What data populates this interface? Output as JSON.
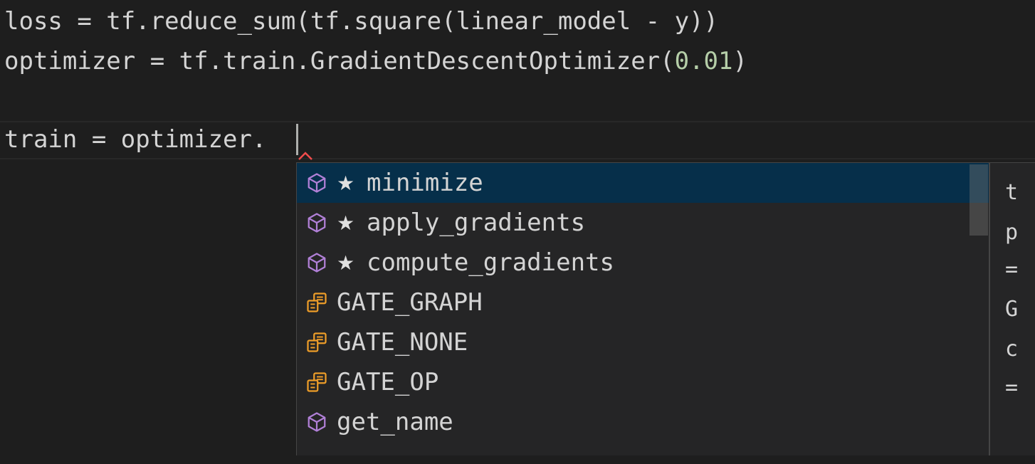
{
  "editor": {
    "lines": [
      {
        "text": "loss = tf.reduce_sum(tf.square(linear_model - y))"
      },
      {
        "prefix": "optimizer = tf.train.GradientDescentOptimizer(",
        "number": "0.01",
        "suffix": ")"
      },
      {
        "text": "train = optimizer."
      }
    ]
  },
  "suggest": {
    "items": [
      {
        "label": "minimize",
        "starred": true,
        "kind": "method",
        "icon": "method-cube-icon",
        "selected": true
      },
      {
        "label": "apply_gradients",
        "starred": true,
        "kind": "method",
        "icon": "method-cube-icon",
        "selected": false
      },
      {
        "label": "compute_gradients",
        "starred": true,
        "kind": "method",
        "icon": "method-cube-icon",
        "selected": false
      },
      {
        "label": "GATE_GRAPH",
        "starred": false,
        "kind": "constant",
        "icon": "enum-member-icon",
        "selected": false
      },
      {
        "label": "GATE_NONE",
        "starred": false,
        "kind": "constant",
        "icon": "enum-member-icon",
        "selected": false
      },
      {
        "label": "GATE_OP",
        "starred": false,
        "kind": "constant",
        "icon": "enum-member-icon",
        "selected": false
      },
      {
        "label": "get_name",
        "starred": false,
        "kind": "method",
        "icon": "method-cube-icon",
        "selected": false
      }
    ],
    "star": "★",
    "details_fragments": [
      "t",
      "p",
      "=",
      "G",
      "c",
      "="
    ]
  },
  "colors": {
    "background": "#1e1e1e",
    "text": "#d4d4d4",
    "number": "#b5cea8",
    "method_icon": "#b180d7",
    "constant_icon": "#ee9d28",
    "selected_row": "#062f4a",
    "widget_bg": "#252526"
  }
}
